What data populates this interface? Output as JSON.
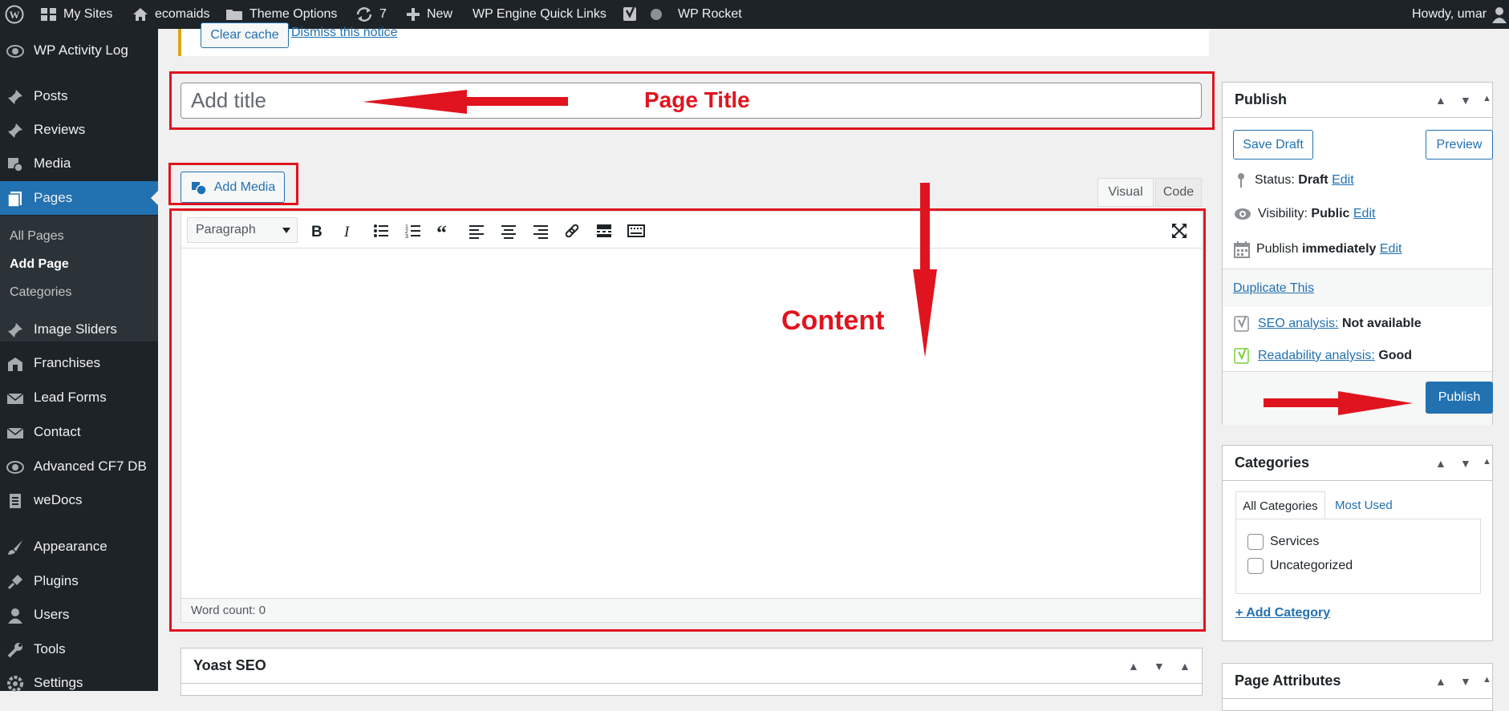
{
  "admin_bar": {
    "my_sites": "My Sites",
    "site_name": "ecomaids",
    "theme_options": "Theme Options",
    "updates_count": "7",
    "new": "New",
    "wp_engine": "WP Engine Quick Links",
    "wp_rocket": "WP Rocket",
    "howdy": "Howdy, umar"
  },
  "sidebar": {
    "items": [
      {
        "label": "WP Activity Log",
        "icon": "eye-icon"
      },
      {
        "label": "Posts",
        "icon": "pin-icon"
      },
      {
        "label": "Reviews",
        "icon": "pin-icon"
      },
      {
        "label": "Media",
        "icon": "media-icon"
      },
      {
        "label": "Pages",
        "icon": "page-icon"
      },
      {
        "label": "Image Sliders",
        "icon": "pin-icon"
      },
      {
        "label": "Franchises",
        "icon": "franchise-icon"
      },
      {
        "label": "Lead Forms",
        "icon": "mail-icon"
      },
      {
        "label": "Contact",
        "icon": "mail-icon"
      },
      {
        "label": "Advanced CF7 DB",
        "icon": "eye-icon"
      },
      {
        "label": "weDocs",
        "icon": "doc-icon"
      },
      {
        "label": "Appearance",
        "icon": "brush-icon"
      },
      {
        "label": "Plugins",
        "icon": "plug-icon"
      },
      {
        "label": "Users",
        "icon": "user-icon"
      },
      {
        "label": "Tools",
        "icon": "wrench-icon"
      },
      {
        "label": "Settings",
        "icon": "settings-icon"
      }
    ],
    "submenu": [
      "All Pages",
      "Add Page",
      "Categories"
    ]
  },
  "notice": {
    "clear_cache": "Clear cache",
    "dismiss": "Dismiss this notice"
  },
  "editor": {
    "title_placeholder": "Add title",
    "add_media": "Add Media",
    "tab_visual": "Visual",
    "tab_code": "Code",
    "format": "Paragraph",
    "word_count": "Word count: 0"
  },
  "annotations": {
    "page_title": "Page Title",
    "content": "Content",
    "color": "#e0141e"
  },
  "publish": {
    "title": "Publish",
    "save_draft": "Save Draft",
    "preview": "Preview",
    "status_label": "Status:",
    "status_value": "Draft",
    "visibility_label": "Visibility:",
    "visibility_value": "Public",
    "publish_label": "Publish",
    "publish_value": "immediately",
    "edit": "Edit",
    "duplicate": "Duplicate This",
    "seo_label": "SEO analysis:",
    "seo_value": "Not available",
    "readability_label": "Readability analysis:",
    "readability_value": "Good",
    "publish_button": "Publish"
  },
  "categories": {
    "title": "Categories",
    "tab_all": "All Categories",
    "tab_most": "Most Used",
    "items": [
      "Services",
      "Uncategorized"
    ],
    "add": "+ Add Category"
  },
  "yoast": {
    "title": "Yoast SEO"
  },
  "page_attributes": {
    "title": "Page Attributes"
  },
  "colors": {
    "admin_bar": "#1d2327",
    "accent": "#2271b1",
    "annotation": "#e0141e"
  }
}
